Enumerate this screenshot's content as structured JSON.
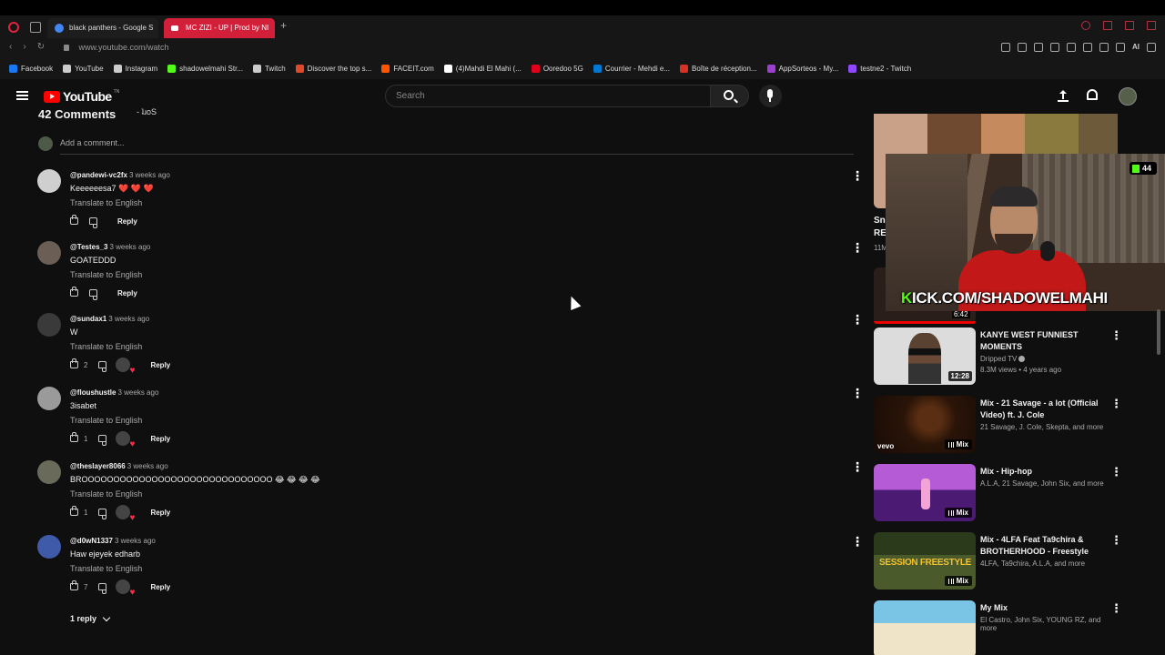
{
  "browser": {
    "tabs": [
      {
        "label": "black panthers - Google S",
        "active": false
      },
      {
        "label": "MC ZIZI - UP | Prod by NI",
        "active": true
      }
    ],
    "url": "www.youtube.com/watch",
    "ai_label": "AI",
    "bookmarks": [
      {
        "label": "Facebook",
        "color": "#1877f2"
      },
      {
        "label": "YouTube",
        "color": "#cccccc"
      },
      {
        "label": "Instagram",
        "color": "#cccccc"
      },
      {
        "label": "shadowelmahi Str...",
        "color": "#53fc18"
      },
      {
        "label": "Twitch",
        "color": "#cccccc"
      },
      {
        "label": "Discover the top s...",
        "color": "#e04a2a"
      },
      {
        "label": "FACEIT.com",
        "color": "#ff5500"
      },
      {
        "label": "(4)Mahdi El Mahi (...",
        "color": "#ffffff"
      },
      {
        "label": "Ooredoo 5G",
        "color": "#e2001a"
      },
      {
        "label": "Courrier - Mehdi e...",
        "color": "#0078d4"
      },
      {
        "label": "Boîte de réception...",
        "color": "#d93025"
      },
      {
        "label": "AppSorteos - My...",
        "color": "#9b3fd1"
      },
      {
        "label": "testne2 - Twitch",
        "color": "#9146ff"
      }
    ]
  },
  "youtube": {
    "logo_text": "YouTube",
    "logo_sup": "TN",
    "search_placeholder": "Search"
  },
  "comments": {
    "count_label": "42 Comments",
    "sort_fragment": "- ʇɹoS",
    "add_placeholder": "Add a comment...",
    "translate_label": "Translate to English",
    "reply_label": "Reply",
    "items": [
      {
        "user": "@pandewi-vc2fx",
        "time": "3 weeks ago",
        "text": "Keeeeeesa7 ❤️ ❤️ ❤️",
        "likes": "",
        "hearted": false,
        "avatar_color": "#cfcfcf"
      },
      {
        "user": "@Testes_3",
        "time": "3 weeks ago",
        "text": "GOATEDDD",
        "likes": "",
        "hearted": false,
        "avatar_color": "#6b5e55"
      },
      {
        "user": "@sundax1",
        "time": "3 weeks ago",
        "text": "W",
        "likes": "2",
        "hearted": true,
        "avatar_color": "#3a3a3a"
      },
      {
        "user": "@floushustle",
        "time": "3 weeks ago",
        "text": "3isabet",
        "likes": "1",
        "hearted": true,
        "avatar_color": "#9a9a9a"
      },
      {
        "user": "@theslayer8066",
        "time": "3 weeks ago",
        "text": "BROOOOOOOOOOOOOOOOOOOOOOOOOOOOOO 😂 😂 😂 😂",
        "likes": "1",
        "hearted": true,
        "avatar_color": "#6a6a5a"
      },
      {
        "user": "@d0wN1337",
        "time": "3 weeks ago",
        "text": "Haw ejeyek edharb",
        "likes": "7",
        "hearted": true,
        "avatar_color": "#3f5aa8"
      }
    ],
    "replies_toggle": "1 reply"
  },
  "sidebar": {
    "fragments": [
      "Sno",
      "REA",
      "11M"
    ],
    "hidden_duration": "6:42",
    "stream_overlay": {
      "viewers": "44",
      "banner_k": "K",
      "banner_rest": "ICK.COM/SHADOWELMAHI"
    },
    "items": [
      {
        "title": "KANYE WEST FUNNIEST MOMENTS",
        "channel": "Dripped TV",
        "meta": "8.3M views • 4 years ago",
        "badge": "12:28",
        "type": "video",
        "verified": true
      },
      {
        "title": "Mix - 21 Savage - a lot (Official Video) ft. J. Cole",
        "channel": "21 Savage, J. Cole, Skepta, and more",
        "meta": "",
        "badge": "Mix",
        "type": "mix",
        "vevo": "vevo"
      },
      {
        "title": "Mix - Hip-hop",
        "channel": "A.L.A, 21 Savage, John Six, and more",
        "meta": "",
        "badge": "Mix",
        "type": "mix"
      },
      {
        "title": "Mix - 4LFA Feat Ta9chira & BROTHERHOOD - Freestyle",
        "channel": "4LFA, Ta9chira, A.L.A, and more",
        "meta": "",
        "badge": "Mix",
        "type": "mix"
      },
      {
        "title": "My Mix",
        "channel": "El Castro, John Six, YOUNG RZ, and more",
        "meta": "",
        "badge": "",
        "type": "mix"
      }
    ]
  },
  "colors": {
    "accent": "#ff0000",
    "heart": "#ff2a4a",
    "kick_green": "#53fc18",
    "opera_red": "#d2203b"
  }
}
